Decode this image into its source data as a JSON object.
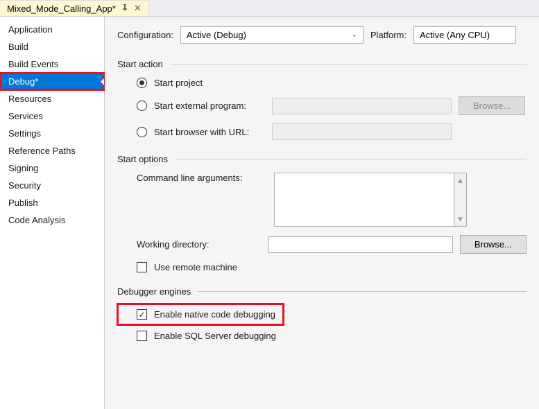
{
  "tab": {
    "title": "Mixed_Mode_Calling_App*"
  },
  "sidebar": {
    "items": [
      {
        "label": "Application"
      },
      {
        "label": "Build"
      },
      {
        "label": "Build Events"
      },
      {
        "label": "Debug*"
      },
      {
        "label": "Resources"
      },
      {
        "label": "Services"
      },
      {
        "label": "Settings"
      },
      {
        "label": "Reference Paths"
      },
      {
        "label": "Signing"
      },
      {
        "label": "Security"
      },
      {
        "label": "Publish"
      },
      {
        "label": "Code Analysis"
      }
    ]
  },
  "top": {
    "configuration_label": "Configuration:",
    "configuration_value": "Active (Debug)",
    "platform_label": "Platform:",
    "platform_value": "Active (Any CPU)"
  },
  "sections": {
    "start_action": {
      "title": "Start action",
      "start_project": "Start project",
      "start_external": "Start external program:",
      "start_browser": "Start browser with URL:",
      "browse": "Browse..."
    },
    "start_options": {
      "title": "Start options",
      "cmd_args": "Command line arguments:",
      "working_dir": "Working directory:",
      "browse": "Browse...",
      "use_remote": "Use remote machine"
    },
    "debugger": {
      "title": "Debugger engines",
      "enable_native": "Enable native code debugging",
      "enable_sql": "Enable SQL Server debugging"
    }
  }
}
